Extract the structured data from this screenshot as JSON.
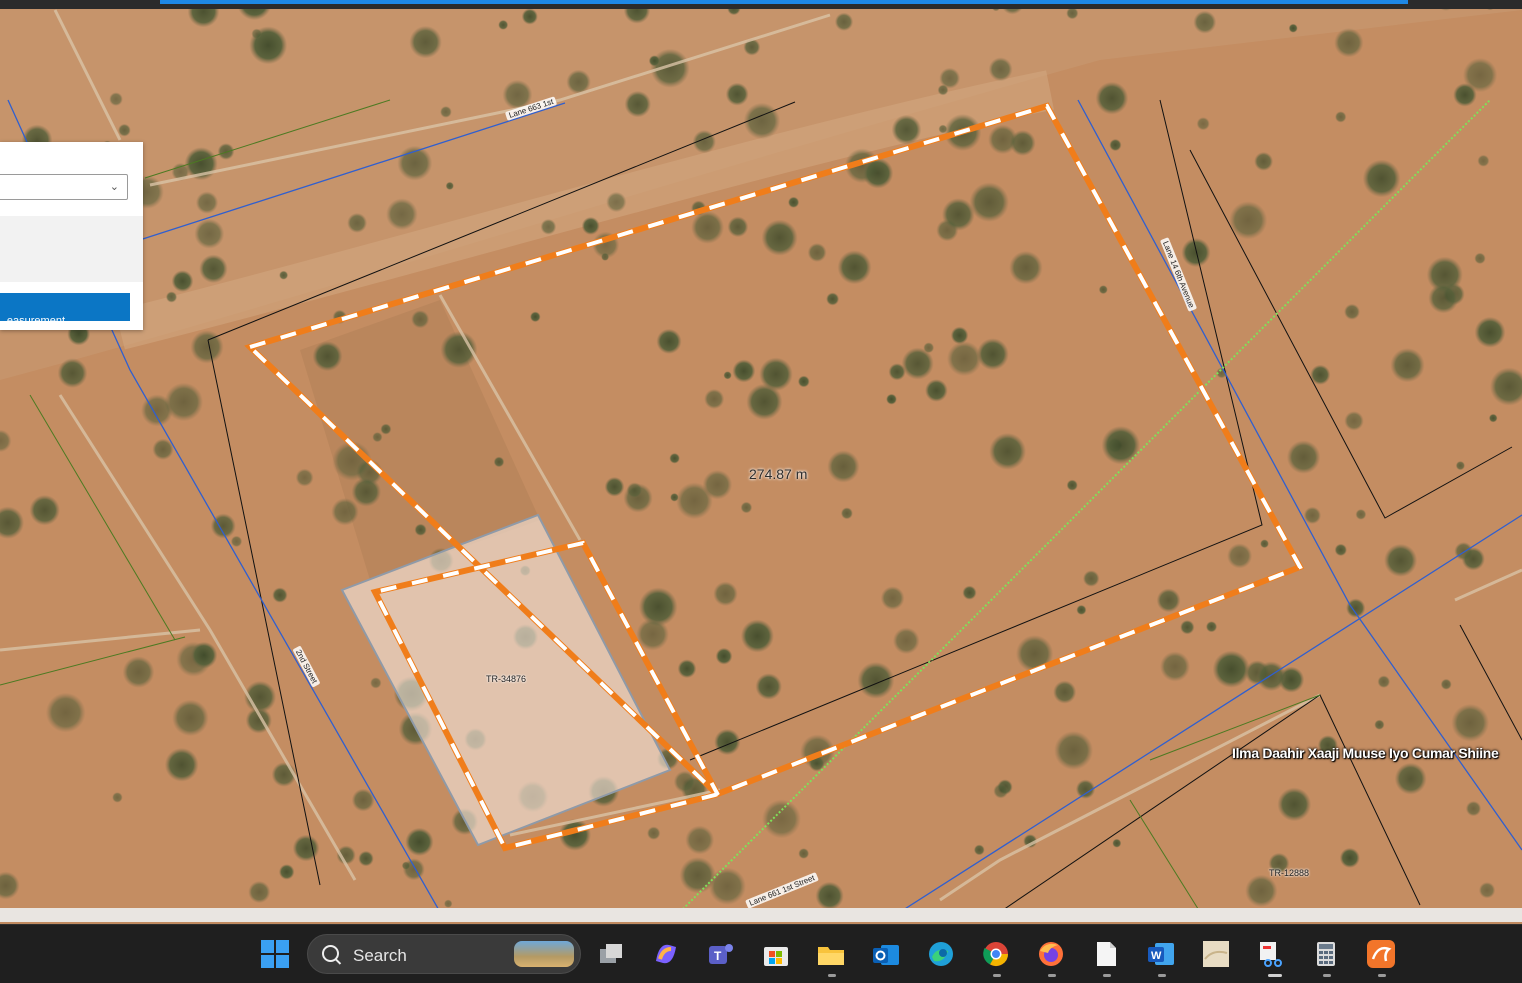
{
  "map": {
    "measurement_label": "274.87 m",
    "place_label": "Ilma Daahir Xaaji Muuse Iyo Cumar Shiine",
    "parcels": [
      "TR-34876",
      "TR-12888"
    ],
    "streets": [
      "Lane 663 1st",
      "Lane 14 6th Avenue",
      "2nd Street",
      "Lane 661 1st Street"
    ],
    "colors": {
      "measure_orange": "#f07d1a",
      "measure_dash": "#ffffff",
      "parcel_line": "#111111",
      "road_line": "#2f5fd0",
      "boundary_green": "#4c7a22",
      "gps_green": "#7fe05a"
    }
  },
  "panel": {
    "measurement_button": "easurement",
    "dropdown_icon": "chevron-down-icon"
  },
  "taskbar": {
    "search_placeholder": "Search",
    "apps": [
      {
        "name": "windows-start-icon"
      },
      {
        "name": "task-view-icon"
      },
      {
        "name": "copilot-icon"
      },
      {
        "name": "teams-icon"
      },
      {
        "name": "microsoft-store-icon"
      },
      {
        "name": "file-explorer-icon"
      },
      {
        "name": "outlook-icon"
      },
      {
        "name": "edge-icon"
      },
      {
        "name": "chrome-icon"
      },
      {
        "name": "firefox-icon"
      },
      {
        "name": "notepad-icon"
      },
      {
        "name": "word-icon"
      },
      {
        "name": "map-app-icon"
      },
      {
        "name": "snipping-tool-icon"
      },
      {
        "name": "calculator-icon"
      },
      {
        "name": "orange-app-icon"
      }
    ]
  }
}
